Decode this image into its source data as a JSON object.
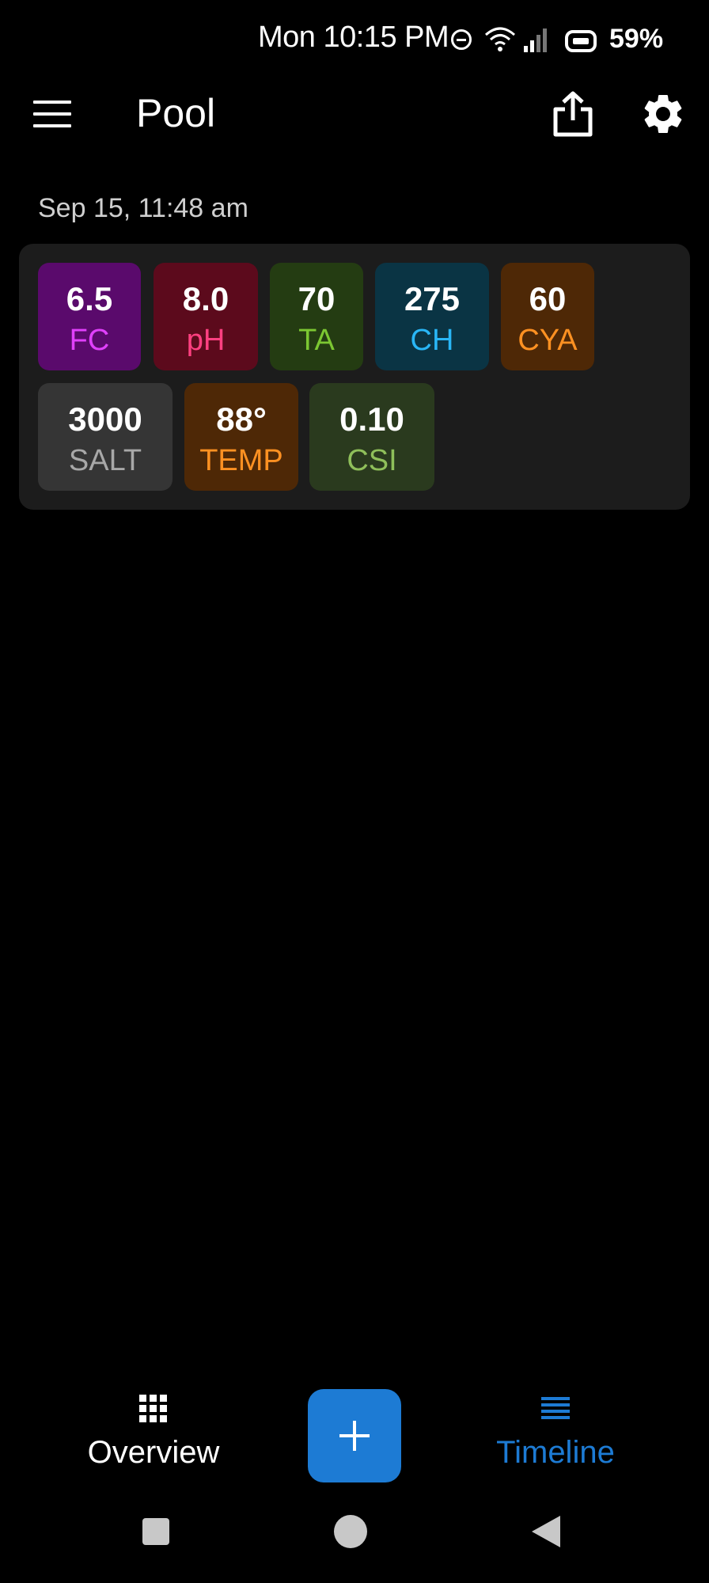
{
  "status_bar": {
    "time": "Mon 10:15 PM",
    "battery": "59%"
  },
  "app_bar": {
    "title": "Pool"
  },
  "reading_date": "Sep 15, 11:48 am",
  "readings": [
    {
      "value": "6.5",
      "label": "FC",
      "bg": "#5a0a6c",
      "color": "#e040fb"
    },
    {
      "value": "8.0",
      "label": "pH",
      "bg": "#5c0a1c",
      "color": "#ff4081"
    },
    {
      "value": "70",
      "label": "TA",
      "bg": "#243c12",
      "color": "#7cc732"
    },
    {
      "value": "275",
      "label": "CH",
      "bg": "#0a3444",
      "color": "#29b6f6"
    },
    {
      "value": "60",
      "label": "CYA",
      "bg": "#4e2806",
      "color": "#ff9122"
    },
    {
      "value": "3000",
      "label": "SALT",
      "bg": "#353535",
      "color": "#a8a8a8"
    },
    {
      "value": "88°",
      "label": "TEMP",
      "bg": "#4e2806",
      "color": "#ff9122"
    },
    {
      "value": "0.10",
      "label": "CSI",
      "bg": "#2a3a1e",
      "color": "#8fbf5a"
    }
  ],
  "bottom_nav": {
    "overview_label": "Overview",
    "timeline_label": "Timeline",
    "active_color": "#1d7bd4",
    "icons": {
      "overview": "grid-icon",
      "add": "plus-icon",
      "timeline": "list-icon"
    }
  }
}
